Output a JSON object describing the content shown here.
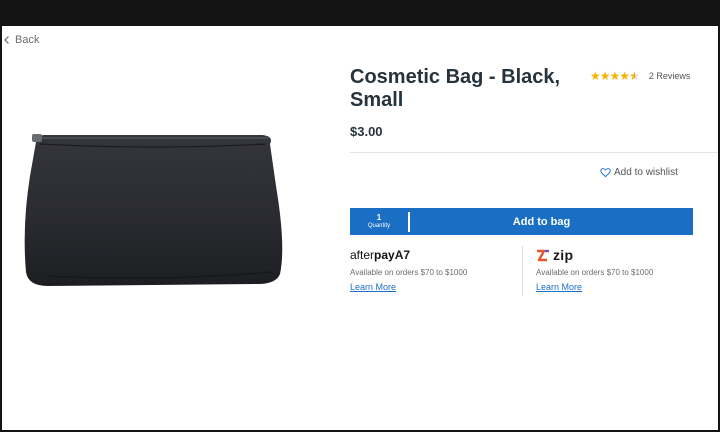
{
  "nav": {
    "back_label": "Back"
  },
  "product": {
    "title": "Cosmetic Bag - Black, Small",
    "price": "$3.00",
    "rating": 4.5,
    "reviews_label": "2 Reviews",
    "color": "#2a2b2f"
  },
  "wishlist": {
    "label": "Add to wishlist"
  },
  "bag": {
    "quantity_value": "1",
    "quantity_label": "Quantity",
    "add_label": "Add to bag",
    "accent": "#1a6ec4"
  },
  "afterpay": {
    "brand_plain": "after",
    "brand_bold": "pay",
    "brand_mark": "A7",
    "note": "Available on orders $70 to $1000",
    "link": "Learn More"
  },
  "zip": {
    "brand": "zip",
    "note": "Available on orders $70 to $1000",
    "link": "Learn More"
  },
  "icons": {
    "back": "chevron-left-icon",
    "wishlist": "heart-icon",
    "zip": "zip-logo-icon"
  }
}
